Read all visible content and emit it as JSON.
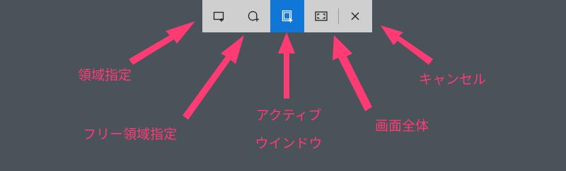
{
  "toolbar": {
    "buttons": [
      {
        "id": "rect",
        "icon": "rectangular-snip-icon",
        "active": false
      },
      {
        "id": "freeform",
        "icon": "freeform-snip-icon",
        "active": false
      },
      {
        "id": "window",
        "icon": "window-snip-icon",
        "active": true
      },
      {
        "id": "fullscreen",
        "icon": "fullscreen-snip-icon",
        "active": false
      },
      {
        "id": "close",
        "icon": "close-icon",
        "active": false
      }
    ]
  },
  "annotations": {
    "rect": "領域指定",
    "freeform": "フリー領域指定",
    "window_line1": "アクティブ",
    "window_line2": "ウインドウ",
    "fullscreen": "画面全体",
    "close": "キャンセル"
  },
  "colors": {
    "background": "#4a525a",
    "toolbar": "#cfcfcf",
    "active": "#1177d6",
    "annotation": "#ff3b74"
  }
}
